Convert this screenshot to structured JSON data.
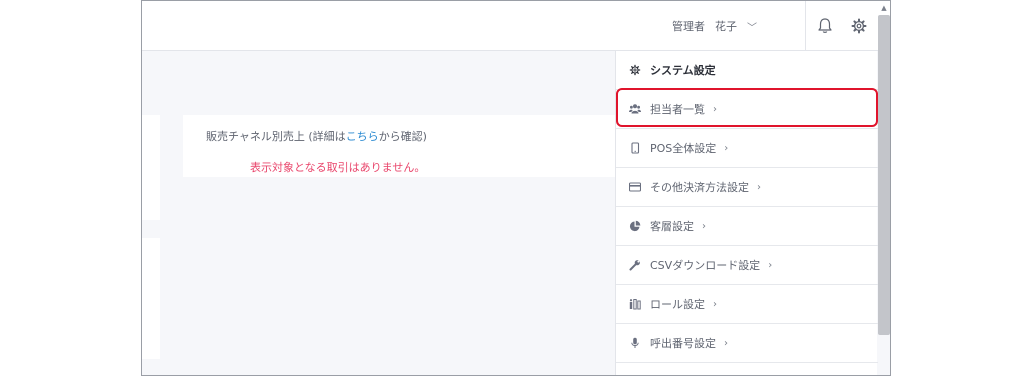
{
  "header": {
    "role_label": "管理者",
    "user_name": "花子",
    "user_chevron": "﹀"
  },
  "sales_card": {
    "title_prefix": "販売チャネル別売上 (詳細は",
    "title_link": "こちら",
    "title_suffix": "から確認)",
    "empty_message": "表示対象となる取引はありません。"
  },
  "settings_menu": {
    "items": [
      {
        "label": "システム設定",
        "icon": "gear-icon"
      },
      {
        "label": "担当者一覧",
        "icon": "users-icon"
      },
      {
        "label": "POS全体設定",
        "icon": "tablet-icon"
      },
      {
        "label": "その他決済方法設定",
        "icon": "credit-card-icon"
      },
      {
        "label": "客層設定",
        "icon": "pie-chart-icon"
      },
      {
        "label": "CSVダウンロード設定",
        "icon": "wrench-icon"
      },
      {
        "label": "ロール設定",
        "icon": "roles-icon"
      },
      {
        "label": "呼出番号設定",
        "icon": "microphone-icon"
      }
    ],
    "chevron": "›"
  },
  "colors": {
    "highlight": "#e0142c",
    "link": "#2a8ad1",
    "empty_message": "#e9456b"
  }
}
